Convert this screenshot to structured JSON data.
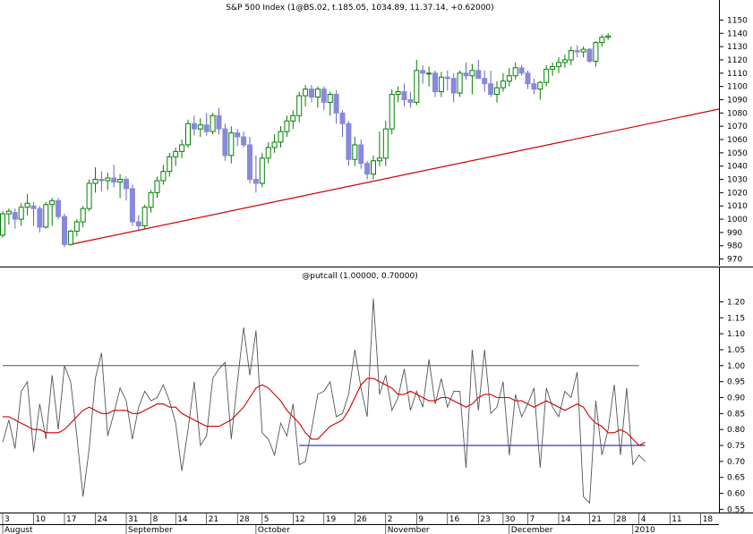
{
  "chart_data": [
    {
      "type": "candlestick",
      "title": "S&P 500 Index (1@BS.02, t.185.05, 1034.89, 11.37.14, +0.62000)",
      "ylim": [
        965,
        1155
      ],
      "yticks": [
        970,
        980,
        990,
        1000,
        1010,
        1020,
        1030,
        1040,
        1050,
        1060,
        1070,
        1080,
        1090,
        1100,
        1110,
        1120,
        1130,
        1140,
        1150
      ],
      "trendline": {
        "start": {
          "index": 11,
          "value": 981
        },
        "end": {
          "index": 116,
          "value": 1083
        },
        "color": "#cc0000"
      },
      "up_color": "#008000",
      "down_color": "#8888dd",
      "candles": [
        {
          "o": 988,
          "h": 1006,
          "l": 986,
          "c": 1004
        },
        {
          "o": 1004,
          "h": 1008,
          "l": 996,
          "c": 1006
        },
        {
          "o": 1005,
          "h": 1008,
          "l": 993,
          "c": 1000
        },
        {
          "o": 1000,
          "h": 1012,
          "l": 995,
          "c": 1009
        },
        {
          "o": 1009,
          "h": 1019,
          "l": 1003,
          "c": 1012
        },
        {
          "o": 1010,
          "h": 1013,
          "l": 995,
          "c": 1008
        },
        {
          "o": 1008,
          "h": 1010,
          "l": 990,
          "c": 994
        },
        {
          "o": 994,
          "h": 1013,
          "l": 993,
          "c": 1011
        },
        {
          "o": 1011,
          "h": 1016,
          "l": 995,
          "c": 1014
        },
        {
          "o": 1014,
          "h": 1016,
          "l": 1000,
          "c": 1002
        },
        {
          "o": 1002,
          "h": 1004,
          "l": 979,
          "c": 981
        },
        {
          "o": 981,
          "h": 992,
          "l": 980,
          "c": 991
        },
        {
          "o": 991,
          "h": 1000,
          "l": 987,
          "c": 998
        },
        {
          "o": 998,
          "h": 1010,
          "l": 994,
          "c": 1008
        },
        {
          "o": 1008,
          "h": 1030,
          "l": 1006,
          "c": 1027
        },
        {
          "o": 1027,
          "h": 1039,
          "l": 1020,
          "c": 1030
        },
        {
          "o": 1030,
          "h": 1036,
          "l": 1021,
          "c": 1029
        },
        {
          "o": 1029,
          "h": 1035,
          "l": 1022,
          "c": 1031
        },
        {
          "o": 1031,
          "h": 1041,
          "l": 1024,
          "c": 1028
        },
        {
          "o": 1028,
          "h": 1034,
          "l": 1016,
          "c": 1030
        },
        {
          "o": 1030,
          "h": 1032,
          "l": 1014,
          "c": 1023
        },
        {
          "o": 1023,
          "h": 1026,
          "l": 995,
          "c": 998
        },
        {
          "o": 998,
          "h": 1003,
          "l": 992,
          "c": 995
        },
        {
          "o": 995,
          "h": 1011,
          "l": 993,
          "c": 1009
        },
        {
          "o": 1009,
          "h": 1022,
          "l": 1005,
          "c": 1020
        },
        {
          "o": 1020,
          "h": 1032,
          "l": 1016,
          "c": 1029
        },
        {
          "o": 1029,
          "h": 1041,
          "l": 1026,
          "c": 1036
        },
        {
          "o": 1036,
          "h": 1050,
          "l": 1032,
          "c": 1047
        },
        {
          "o": 1047,
          "h": 1054,
          "l": 1040,
          "c": 1051
        },
        {
          "o": 1051,
          "h": 1060,
          "l": 1046,
          "c": 1056
        },
        {
          "o": 1056,
          "h": 1075,
          "l": 1054,
          "c": 1072
        },
        {
          "o": 1072,
          "h": 1078,
          "l": 1063,
          "c": 1068
        },
        {
          "o": 1068,
          "h": 1076,
          "l": 1062,
          "c": 1071
        },
        {
          "o": 1071,
          "h": 1080,
          "l": 1063,
          "c": 1066
        },
        {
          "o": 1066,
          "h": 1080,
          "l": 1064,
          "c": 1078
        },
        {
          "o": 1078,
          "h": 1084,
          "l": 1064,
          "c": 1068
        },
        {
          "o": 1068,
          "h": 1072,
          "l": 1044,
          "c": 1048
        },
        {
          "o": 1048,
          "h": 1070,
          "l": 1042,
          "c": 1065
        },
        {
          "o": 1065,
          "h": 1068,
          "l": 1055,
          "c": 1062
        },
        {
          "o": 1062,
          "h": 1066,
          "l": 1054,
          "c": 1056
        },
        {
          "o": 1056,
          "h": 1062,
          "l": 1027,
          "c": 1030
        },
        {
          "o": 1030,
          "h": 1048,
          "l": 1020,
          "c": 1027
        },
        {
          "o": 1027,
          "h": 1050,
          "l": 1024,
          "c": 1046
        },
        {
          "o": 1046,
          "h": 1058,
          "l": 1042,
          "c": 1054
        },
        {
          "o": 1054,
          "h": 1064,
          "l": 1050,
          "c": 1058
        },
        {
          "o": 1058,
          "h": 1070,
          "l": 1054,
          "c": 1066
        },
        {
          "o": 1066,
          "h": 1078,
          "l": 1062,
          "c": 1074
        },
        {
          "o": 1074,
          "h": 1082,
          "l": 1068,
          "c": 1078
        },
        {
          "o": 1078,
          "h": 1096,
          "l": 1073,
          "c": 1093
        },
        {
          "o": 1093,
          "h": 1101,
          "l": 1085,
          "c": 1098
        },
        {
          "o": 1098,
          "h": 1101,
          "l": 1088,
          "c": 1092
        },
        {
          "o": 1092,
          "h": 1100,
          "l": 1084,
          "c": 1098
        },
        {
          "o": 1098,
          "h": 1100,
          "l": 1082,
          "c": 1088
        },
        {
          "o": 1088,
          "h": 1096,
          "l": 1078,
          "c": 1094
        },
        {
          "o": 1094,
          "h": 1097,
          "l": 1072,
          "c": 1080
        },
        {
          "o": 1080,
          "h": 1082,
          "l": 1062,
          "c": 1072
        },
        {
          "o": 1072,
          "h": 1074,
          "l": 1040,
          "c": 1045
        },
        {
          "o": 1045,
          "h": 1062,
          "l": 1040,
          "c": 1056
        },
        {
          "o": 1056,
          "h": 1060,
          "l": 1038,
          "c": 1042
        },
        {
          "o": 1042,
          "h": 1044,
          "l": 1030,
          "c": 1034
        },
        {
          "o": 1034,
          "h": 1048,
          "l": 1030,
          "c": 1044
        },
        {
          "o": 1044,
          "h": 1066,
          "l": 1040,
          "c": 1046
        },
        {
          "o": 1046,
          "h": 1074,
          "l": 1040,
          "c": 1068
        },
        {
          "o": 1068,
          "h": 1098,
          "l": 1064,
          "c": 1094
        },
        {
          "o": 1094,
          "h": 1100,
          "l": 1088,
          "c": 1096
        },
        {
          "o": 1096,
          "h": 1102,
          "l": 1085,
          "c": 1090
        },
        {
          "o": 1090,
          "h": 1096,
          "l": 1084,
          "c": 1088
        },
        {
          "o": 1088,
          "h": 1120,
          "l": 1086,
          "c": 1112
        },
        {
          "o": 1112,
          "h": 1116,
          "l": 1102,
          "c": 1110
        },
        {
          "o": 1110,
          "h": 1115,
          "l": 1100,
          "c": 1110
        },
        {
          "o": 1110,
          "h": 1112,
          "l": 1092,
          "c": 1096
        },
        {
          "o": 1096,
          "h": 1111,
          "l": 1092,
          "c": 1107
        },
        {
          "o": 1107,
          "h": 1112,
          "l": 1097,
          "c": 1106
        },
        {
          "o": 1106,
          "h": 1110,
          "l": 1088,
          "c": 1095
        },
        {
          "o": 1095,
          "h": 1112,
          "l": 1092,
          "c": 1110
        },
        {
          "o": 1110,
          "h": 1118,
          "l": 1105,
          "c": 1108
        },
        {
          "o": 1108,
          "h": 1117,
          "l": 1094,
          "c": 1112
        },
        {
          "o": 1112,
          "h": 1120,
          "l": 1106,
          "c": 1106
        },
        {
          "o": 1106,
          "h": 1112,
          "l": 1096,
          "c": 1102
        },
        {
          "o": 1102,
          "h": 1112,
          "l": 1092,
          "c": 1094
        },
        {
          "o": 1094,
          "h": 1104,
          "l": 1088,
          "c": 1099
        },
        {
          "o": 1099,
          "h": 1110,
          "l": 1096,
          "c": 1104
        },
        {
          "o": 1104,
          "h": 1114,
          "l": 1100,
          "c": 1108
        },
        {
          "o": 1108,
          "h": 1118,
          "l": 1105,
          "c": 1114
        },
        {
          "o": 1114,
          "h": 1116,
          "l": 1108,
          "c": 1110
        },
        {
          "o": 1110,
          "h": 1112,
          "l": 1098,
          "c": 1102
        },
        {
          "o": 1102,
          "h": 1106,
          "l": 1094,
          "c": 1098
        },
        {
          "o": 1098,
          "h": 1104,
          "l": 1090,
          "c": 1103
        },
        {
          "o": 1103,
          "h": 1116,
          "l": 1100,
          "c": 1113
        },
        {
          "o": 1113,
          "h": 1118,
          "l": 1108,
          "c": 1115
        },
        {
          "o": 1115,
          "h": 1122,
          "l": 1110,
          "c": 1118
        },
        {
          "o": 1118,
          "h": 1124,
          "l": 1114,
          "c": 1120
        },
        {
          "o": 1120,
          "h": 1130,
          "l": 1116,
          "c": 1127
        },
        {
          "o": 1127,
          "h": 1131,
          "l": 1122,
          "c": 1126
        },
        {
          "o": 1126,
          "h": 1130,
          "l": 1122,
          "c": 1128
        },
        {
          "o": 1128,
          "h": 1129,
          "l": 1118,
          "c": 1119
        },
        {
          "o": 1119,
          "h": 1134,
          "l": 1115,
          "c": 1133
        },
        {
          "o": 1133,
          "h": 1139,
          "l": 1130,
          "c": 1137
        },
        {
          "o": 1137,
          "h": 1140,
          "l": 1135,
          "c": 1138
        }
      ]
    },
    {
      "type": "line",
      "title": "@putcall (1.00000, 0.70000)",
      "ylim": [
        0.54,
        1.26
      ],
      "yticks": [
        "0.55",
        "0.60",
        "0.65",
        "0.70",
        "0.75",
        "0.80",
        "0.85",
        "0.90",
        "0.95",
        "1.00",
        "1.05",
        "1.10",
        "1.15",
        "1.20"
      ],
      "hlines": [
        {
          "value": 1.0,
          "from_index": 0,
          "to_index": 103,
          "color": "#555555"
        },
        {
          "value": 0.75,
          "from_index": 48,
          "to_index": 104,
          "color": "#0000bb"
        }
      ],
      "series": [
        {
          "kind": "putcall",
          "color": "#555555",
          "values": [
            0.76,
            0.83,
            0.74,
            0.92,
            0.95,
            0.73,
            0.88,
            0.77,
            0.97,
            0.8,
            1.0,
            0.95,
            0.78,
            0.59,
            0.74,
            0.96,
            1.04,
            0.78,
            0.85,
            0.93,
            0.89,
            0.77,
            0.87,
            0.92,
            0.89,
            0.9,
            0.94,
            0.89,
            0.82,
            0.67,
            0.8,
            0.95,
            0.75,
            0.78,
            0.96,
            0.99,
            1.01,
            0.77,
            0.95,
            1.12,
            0.97,
            1.11,
            0.79,
            0.77,
            0.72,
            0.82,
            0.78,
            0.88,
            0.69,
            0.7,
            0.8,
            0.91,
            0.92,
            0.95,
            0.84,
            0.85,
            0.91,
            1.05,
            0.93,
            0.84,
            1.21,
            0.91,
            0.97,
            0.86,
            0.9,
            0.99,
            0.86,
            0.92,
            0.87,
            1.02,
            0.88,
            0.96,
            0.87,
            0.92,
            0.92,
            0.68,
            1.05,
            0.86,
            1.05,
            0.85,
            0.87,
            0.95,
            0.72,
            0.91,
            0.84,
            0.88,
            0.93,
            0.68,
            0.93,
            0.87,
            0.84,
            0.92,
            0.9,
            0.98,
            0.59,
            0.57,
            0.89,
            0.72,
            0.8,
            0.94,
            0.72,
            0.93,
            0.69,
            0.72,
            0.7
          ]
        },
        {
          "kind": "moving-average",
          "color": "#cc0000",
          "values": [
            0.84,
            0.84,
            0.83,
            0.82,
            0.81,
            0.8,
            0.8,
            0.79,
            0.79,
            0.79,
            0.8,
            0.82,
            0.84,
            0.86,
            0.87,
            0.86,
            0.85,
            0.85,
            0.86,
            0.86,
            0.86,
            0.85,
            0.85,
            0.86,
            0.87,
            0.88,
            0.88,
            0.87,
            0.87,
            0.85,
            0.84,
            0.83,
            0.82,
            0.81,
            0.81,
            0.81,
            0.82,
            0.83,
            0.85,
            0.87,
            0.9,
            0.93,
            0.94,
            0.93,
            0.91,
            0.89,
            0.86,
            0.84,
            0.82,
            0.79,
            0.77,
            0.77,
            0.79,
            0.81,
            0.82,
            0.83,
            0.86,
            0.9,
            0.94,
            0.96,
            0.96,
            0.95,
            0.94,
            0.93,
            0.91,
            0.91,
            0.92,
            0.91,
            0.9,
            0.89,
            0.89,
            0.9,
            0.9,
            0.89,
            0.88,
            0.87,
            0.88,
            0.9,
            0.91,
            0.91,
            0.9,
            0.9,
            0.9,
            0.89,
            0.89,
            0.88,
            0.87,
            0.88,
            0.89,
            0.88,
            0.87,
            0.86,
            0.87,
            0.88,
            0.87,
            0.84,
            0.82,
            0.81,
            0.79,
            0.79,
            0.8,
            0.79,
            0.77,
            0.75,
            0.76
          ]
        }
      ]
    }
  ],
  "x_axis": {
    "date_labels": [
      {
        "text": "3",
        "index": 0
      },
      {
        "text": "10",
        "index": 5
      },
      {
        "text": "17",
        "index": 10
      },
      {
        "text": "24",
        "index": 15
      },
      {
        "text": "31",
        "index": 20
      },
      {
        "text": "8",
        "index": 24
      },
      {
        "text": "14",
        "index": 28
      },
      {
        "text": "21",
        "index": 33
      },
      {
        "text": "28",
        "index": 38
      },
      {
        "text": "5",
        "index": 42
      },
      {
        "text": "12",
        "index": 47
      },
      {
        "text": "19",
        "index": 52
      },
      {
        "text": "26",
        "index": 57
      },
      {
        "text": "2",
        "index": 62
      },
      {
        "text": "9",
        "index": 67
      },
      {
        "text": "16",
        "index": 72
      },
      {
        "text": "23",
        "index": 77
      },
      {
        "text": "30",
        "index": 81
      },
      {
        "text": "7",
        "index": 85
      },
      {
        "text": "14",
        "index": 90
      },
      {
        "text": "21",
        "index": 95
      },
      {
        "text": "28",
        "index": 99
      },
      {
        "text": "4",
        "index": 103
      },
      {
        "text": "11",
        "index": 108
      },
      {
        "text": "18",
        "index": 113
      }
    ],
    "month_labels": [
      {
        "text": "August",
        "index": 0
      },
      {
        "text": "September",
        "index": 20
      },
      {
        "text": "October",
        "index": 41
      },
      {
        "text": "November",
        "index": 62
      },
      {
        "text": "December",
        "index": 82
      },
      {
        "text": "2010",
        "index": 102
      }
    ]
  }
}
